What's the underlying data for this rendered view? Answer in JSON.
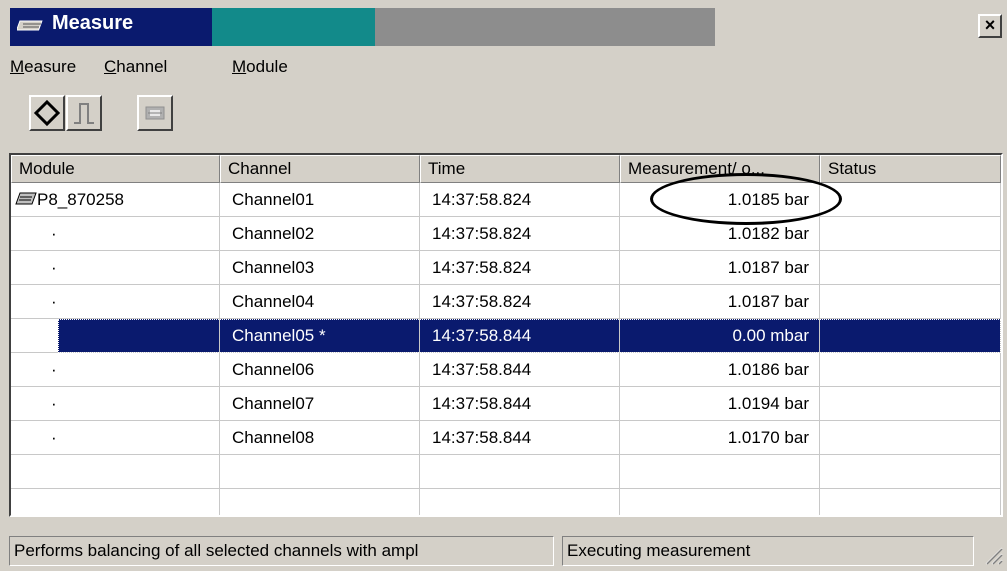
{
  "window": {
    "title": "Measure",
    "close_label": "×"
  },
  "menu": [
    {
      "label": "Measure",
      "accel": "M",
      "rest": "easure"
    },
    {
      "label": "Channel",
      "accel": "C",
      "rest": "hannel"
    },
    {
      "label": "Module",
      "accel": "M",
      "rest": "odule"
    }
  ],
  "toolbar": [
    "start-measure-icon",
    "pulse-icon",
    "balance-icon"
  ],
  "table": {
    "columns": [
      "Module",
      "Channel",
      "Time",
      "Measurement/ o...",
      "Status"
    ],
    "rows": [
      {
        "module": "P8_870258",
        "channel": "Channel01",
        "time": "14:37:58.824",
        "value": "1.0185 bar",
        "status": ""
      },
      {
        "module": "·",
        "channel": "Channel02",
        "time": "14:37:58.824",
        "value": "1.0182 bar",
        "status": ""
      },
      {
        "module": "·",
        "channel": "Channel03",
        "time": "14:37:58.824",
        "value": "1.0187 bar",
        "status": ""
      },
      {
        "module": "·",
        "channel": "Channel04",
        "time": "14:37:58.824",
        "value": "1.0187 bar",
        "status": ""
      },
      {
        "module": "",
        "channel": "Channel05  *",
        "time": "14:37:58.844",
        "value": "0.00 mbar",
        "status": ""
      },
      {
        "module": "·",
        "channel": "Channel06",
        "time": "14:37:58.844",
        "value": "1.0186 bar",
        "status": ""
      },
      {
        "module": "·",
        "channel": "Channel07",
        "time": "14:37:58.844",
        "value": "1.0194 bar",
        "status": ""
      },
      {
        "module": "·",
        "channel": "Channel08",
        "time": "14:37:58.844",
        "value": "1.0170 bar",
        "status": ""
      },
      {
        "module": "",
        "channel": "",
        "time": "",
        "value": "",
        "status": ""
      },
      {
        "module": "",
        "channel": "",
        "time": "",
        "value": "",
        "status": ""
      }
    ],
    "selected_row": 4
  },
  "statusbar": {
    "hint": "Performs balancing of all selected channels with ampl",
    "state": "Executing measurement"
  },
  "colors": {
    "selection": "#0a1a6e",
    "title_active": "#0a1a6e",
    "title_teal": "#128a8a"
  }
}
